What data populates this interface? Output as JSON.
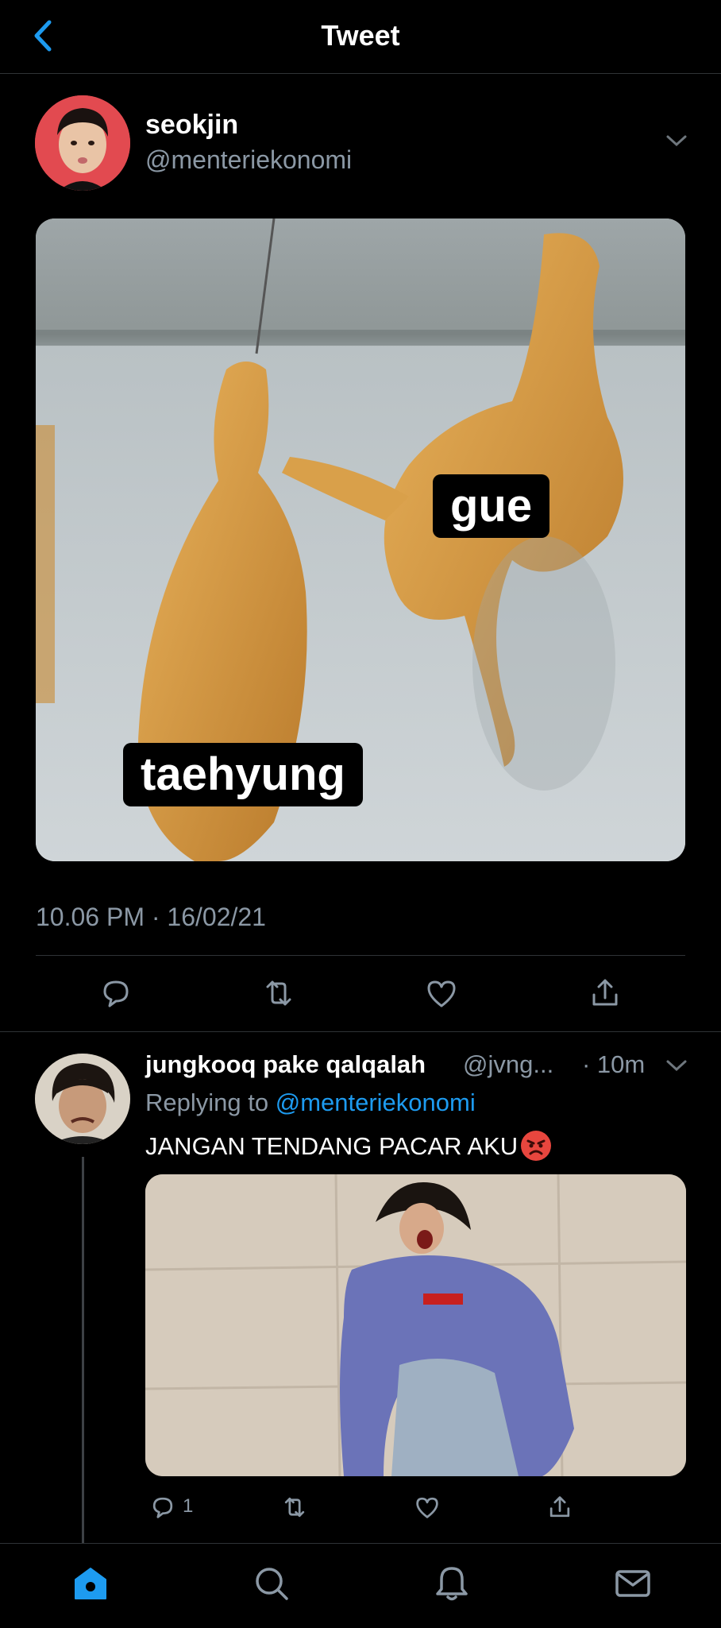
{
  "header": {
    "title": "Tweet"
  },
  "tweet": {
    "display_name": "seokjin",
    "handle": "@menteriekonomi",
    "media_labels": {
      "top": "gue",
      "bottom": "taehyung"
    },
    "timestamp": "10.06 PM · 16/02/21"
  },
  "reply": {
    "display_name": "jungkooq pake qalqalah",
    "handle": "@jvng...",
    "time": "· 10m",
    "replying_prefix": "Replying to ",
    "replying_to": "@menteriekonomi",
    "text": "JANGAN TENDANG PACAR AKU",
    "reply_count": "1"
  },
  "icons": {
    "header": [
      "back-chevron-icon"
    ],
    "actions": [
      "reply-icon",
      "retweet-icon",
      "like-icon",
      "share-icon"
    ],
    "nav": [
      "home-icon",
      "search-icon",
      "notifications-icon",
      "messages-icon"
    ]
  },
  "colors": {
    "accent": "#1d9bf0",
    "muted": "#8b98a5",
    "background": "#000000",
    "divider": "#2f3336"
  }
}
